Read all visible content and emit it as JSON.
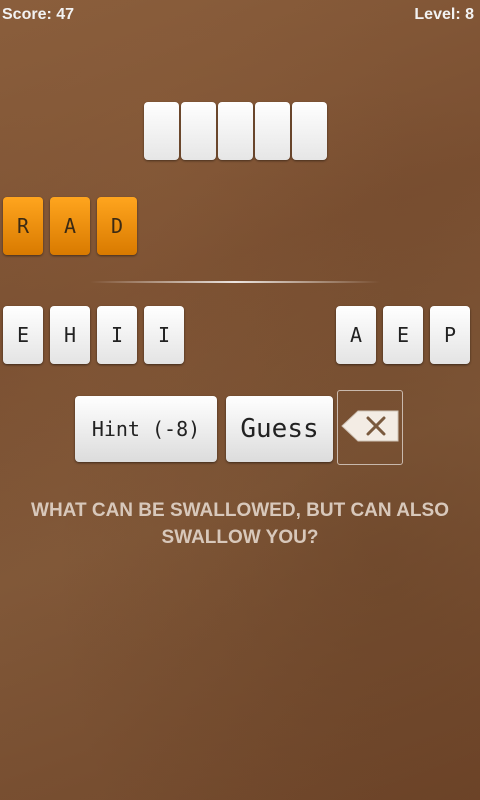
{
  "hud": {
    "score_text": "Score: 47",
    "level_text": "Level: 8"
  },
  "answer": {
    "slot_count": 5
  },
  "used_letters": [
    "R",
    "A",
    "D"
  ],
  "available_left": [
    "E",
    "H",
    "I",
    "I"
  ],
  "available_right": [
    "A",
    "E",
    "P"
  ],
  "buttons": {
    "hint_label": "Hint (-8)",
    "guess_label": "Guess",
    "delete_icon": "backspace-icon"
  },
  "riddle": "WHAT CAN BE SWALLOWED, BUT CAN ALSO SWALLOW YOU?",
  "colors": {
    "tile_orange": "#f59a12",
    "tile_white": "#ffffff",
    "riddle_text": "#d8c8bb"
  }
}
